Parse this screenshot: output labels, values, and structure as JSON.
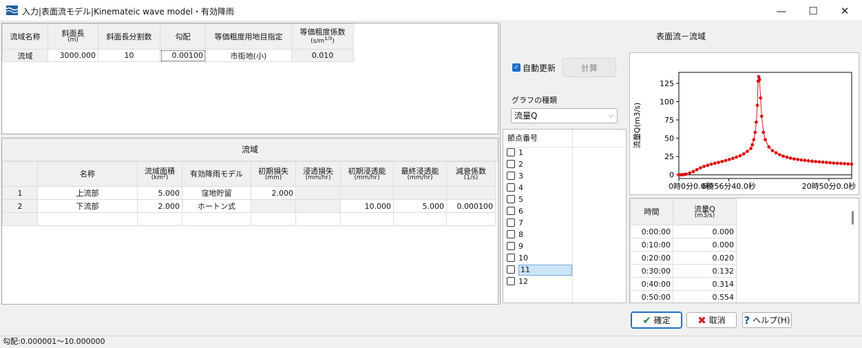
{
  "window": {
    "title": "入力|表面流モデル|Kinemateic wave model・有効降雨",
    "minimize": "—",
    "maximize": "☐",
    "close": "✕"
  },
  "basin_table": {
    "headers": [
      {
        "main": "流域名称",
        "unit": ""
      },
      {
        "main": "斜面長",
        "unit": "(m)"
      },
      {
        "main": "斜面長分割数",
        "unit": ""
      },
      {
        "main": "勾配",
        "unit": ""
      },
      {
        "main": "等価粗度用地目指定",
        "unit": ""
      },
      {
        "main": "等価粗度係数",
        "unit": "(s/m1/3)"
      }
    ],
    "row": [
      "流域",
      "3000.000",
      "10",
      "0.00100",
      "市街地(小)",
      "0.010"
    ]
  },
  "subbasin": {
    "caption": "流域",
    "headers": [
      {
        "main": "",
        "unit": ""
      },
      {
        "main": "名称",
        "unit": ""
      },
      {
        "main": "流域面積",
        "unit": "(km²)"
      },
      {
        "main": "有効降雨モデル",
        "unit": ""
      },
      {
        "main": "初期損失",
        "unit": "(mm)"
      },
      {
        "main": "浸透損失",
        "unit": "(mm/hr)"
      },
      {
        "main": "初期浸透能",
        "unit": "(mm/hr)"
      },
      {
        "main": "最終浸透能",
        "unit": "(mm/hr)"
      },
      {
        "main": "減衰係数",
        "unit": "(1/s)"
      }
    ],
    "rows": [
      [
        "1",
        "上流部",
        "5.000",
        "窪地貯留",
        "2.000",
        "",
        "",
        "",
        ""
      ],
      [
        "2",
        "下流部",
        "2.000",
        "ホートン式",
        "",
        "",
        "10.000",
        "5.000",
        "0.000100"
      ]
    ]
  },
  "right_panel": {
    "header": "表面流－流域",
    "auto_update": "自動更新",
    "calc_button": "計算",
    "graph_type_label": "グラフの種類",
    "graph_type_value": "流量Q",
    "node_header": "節点番号",
    "nodes": [
      "1",
      "2",
      "3",
      "4",
      "5",
      "6",
      "7",
      "8",
      "9",
      "10",
      "11",
      "12"
    ],
    "selected_node": "11"
  },
  "chart_data": {
    "type": "line",
    "ylabel": "流量Q(m3/s)",
    "y_ticks": [
      "0",
      "25",
      "50",
      "75",
      "100",
      "125"
    ],
    "x_tick_labels": [
      "0時0分0.0秒",
      "6時56分40.0秒",
      "20時50分0.0秒"
    ],
    "ylim": [
      -5,
      140
    ],
    "series_color": "#dd1111",
    "series": [
      {
        "x_hours": [
          0,
          0.17,
          0.33,
          0.5,
          0.67,
          0.83,
          1,
          1.5,
          2,
          2.5,
          3,
          3.5,
          4,
          4.5,
          5,
          5.5,
          6,
          6.5,
          7,
          7.5,
          8,
          8.5,
          9,
          9.5,
          10,
          10.2,
          10.4,
          10.6,
          10.75,
          10.9,
          11.0,
          11.1,
          11.2,
          11.35,
          11.5,
          11.75,
          12,
          12.5,
          13,
          13.5,
          14,
          14.5,
          15,
          15.5,
          16,
          16.5,
          17,
          17.5,
          18,
          18.5,
          19,
          19.5,
          20,
          20.5,
          21,
          21.5,
          22,
          22.5,
          23,
          23.5,
          24
        ],
        "q": [
          0.0,
          0.0,
          0.02,
          0.132,
          0.314,
          0.554,
          1.0,
          2.5,
          4.5,
          7,
          9.5,
          11.5,
          13,
          14.5,
          15.8,
          17,
          18.2,
          19.5,
          21,
          22.5,
          24.2,
          26,
          28.5,
          32,
          36,
          41,
          48,
          58,
          72,
          95,
          128,
          134,
          130,
          105,
          80,
          58,
          48,
          38,
          33,
          30,
          27.5,
          25.5,
          24,
          22.8,
          21.8,
          21,
          20.3,
          19.7,
          19.1,
          18.6,
          18.1,
          17.7,
          17.3,
          16.9,
          16.5,
          16.1,
          15.8,
          15.5,
          15.2,
          14.9,
          14.6
        ]
      }
    ]
  },
  "flow_table": {
    "headers": [
      {
        "main": "時間",
        "unit": ""
      },
      {
        "main": "流量Q",
        "unit": "(m3/s)"
      }
    ],
    "rows": [
      [
        "0:00:00",
        "0.000"
      ],
      [
        "0:10:00",
        "0.000"
      ],
      [
        "0:20:00",
        "0.020"
      ],
      [
        "0:30:00",
        "0.132"
      ],
      [
        "0:40:00",
        "0.314"
      ],
      [
        "0:50:00",
        "0.554"
      ]
    ]
  },
  "buttons": {
    "ok": "確定",
    "cancel": "取消",
    "help": "ヘルプ(H)"
  },
  "status": "勾配:0.000001～10.000000",
  "colors": {
    "accent": "#1d6fc8",
    "selection": "#cce4f7",
    "line": "#dd1111"
  }
}
